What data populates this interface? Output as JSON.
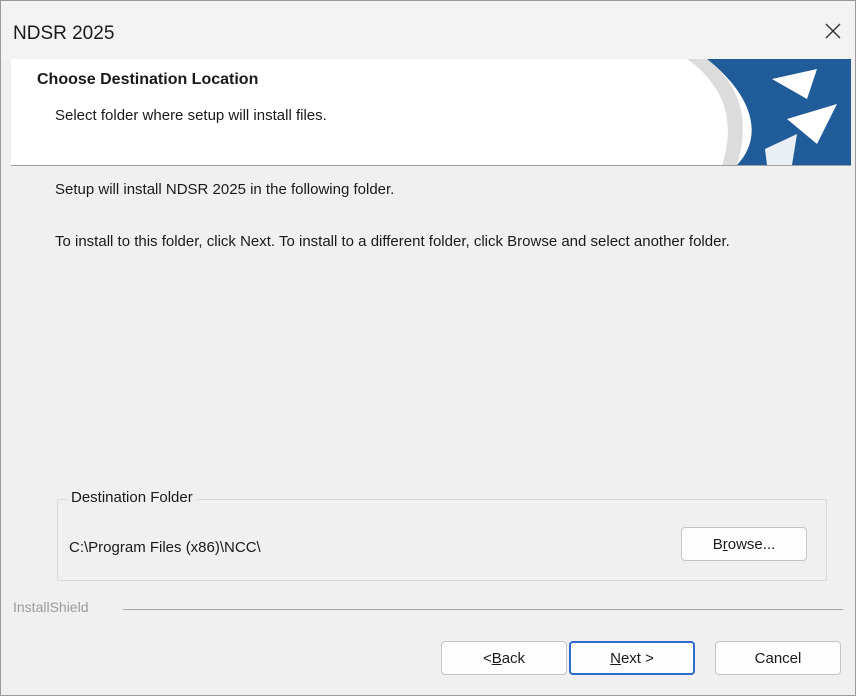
{
  "window": {
    "title": "NDSR 2025"
  },
  "header": {
    "title": "Choose Destination Location",
    "subtitle": "Select folder where setup will install files."
  },
  "body": {
    "line1": "Setup will install NDSR 2025 in the following folder.",
    "line2": "To install to this folder, click Next. To install to a different folder, click Browse and select another folder."
  },
  "destination": {
    "group_label": "Destination Folder",
    "path": "C:\\Program Files (x86)\\NCC\\",
    "browse_label_pre": "B",
    "browse_label_accel": "r",
    "browse_label_post": "owse..."
  },
  "footer": {
    "brand": "InstallShield",
    "back_label_pre": "< ",
    "back_label_accel": "B",
    "back_label_post": "ack",
    "next_label_accel": "N",
    "next_label_post": "ext >",
    "cancel_label": "Cancel"
  },
  "colors": {
    "logo_blue": "#1f5c99",
    "focus_border": "#2f6bc8"
  },
  "icons": {
    "close": "close-icon",
    "logo": "installshield-logo-icon"
  }
}
